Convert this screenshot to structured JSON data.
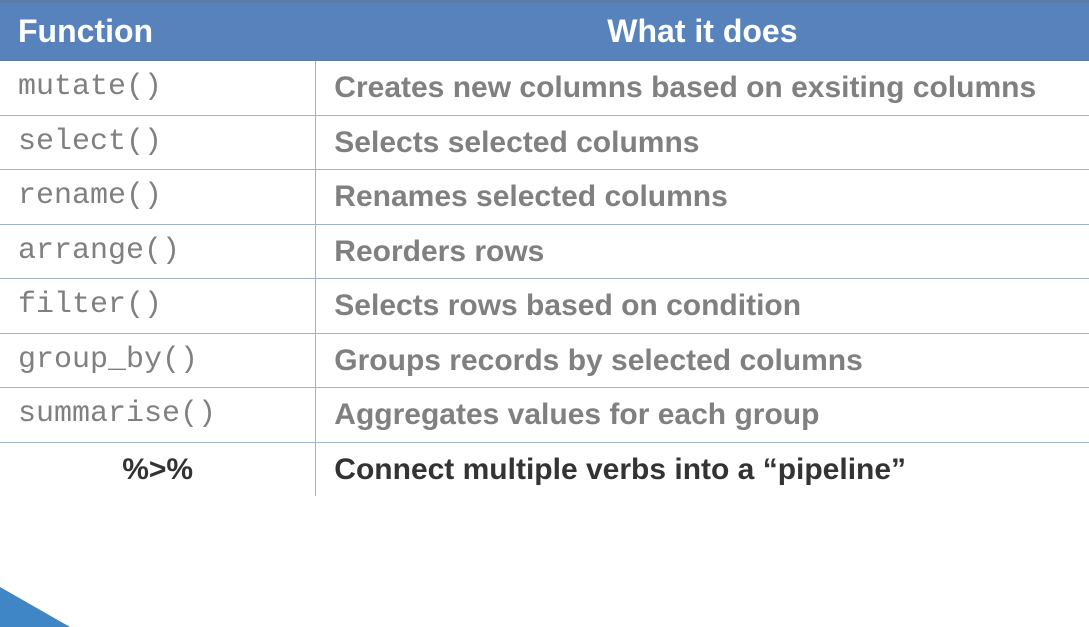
{
  "header": {
    "col1": "Function",
    "col2": "What it does"
  },
  "rows": [
    {
      "fn": "mutate()",
      "desc": "Creates new columns based on exsiting columns",
      "pipe": false
    },
    {
      "fn": "select()",
      "desc": "Selects selected columns",
      "pipe": false
    },
    {
      "fn": "rename()",
      "desc": "Renames selected columns",
      "pipe": false
    },
    {
      "fn": "arrange()",
      "desc": "Reorders rows",
      "pipe": false
    },
    {
      "fn": "filter()",
      "desc": "Selects rows based on condition",
      "pipe": false
    },
    {
      "fn": "group_by()",
      "desc": "Groups records by selected columns",
      "pipe": false
    },
    {
      "fn": "summarise()",
      "desc": "Aggregates values for each group",
      "pipe": false
    },
    {
      "fn": "%>%",
      "desc": "Connect multiple verbs into a “pipeline”",
      "pipe": true
    }
  ]
}
